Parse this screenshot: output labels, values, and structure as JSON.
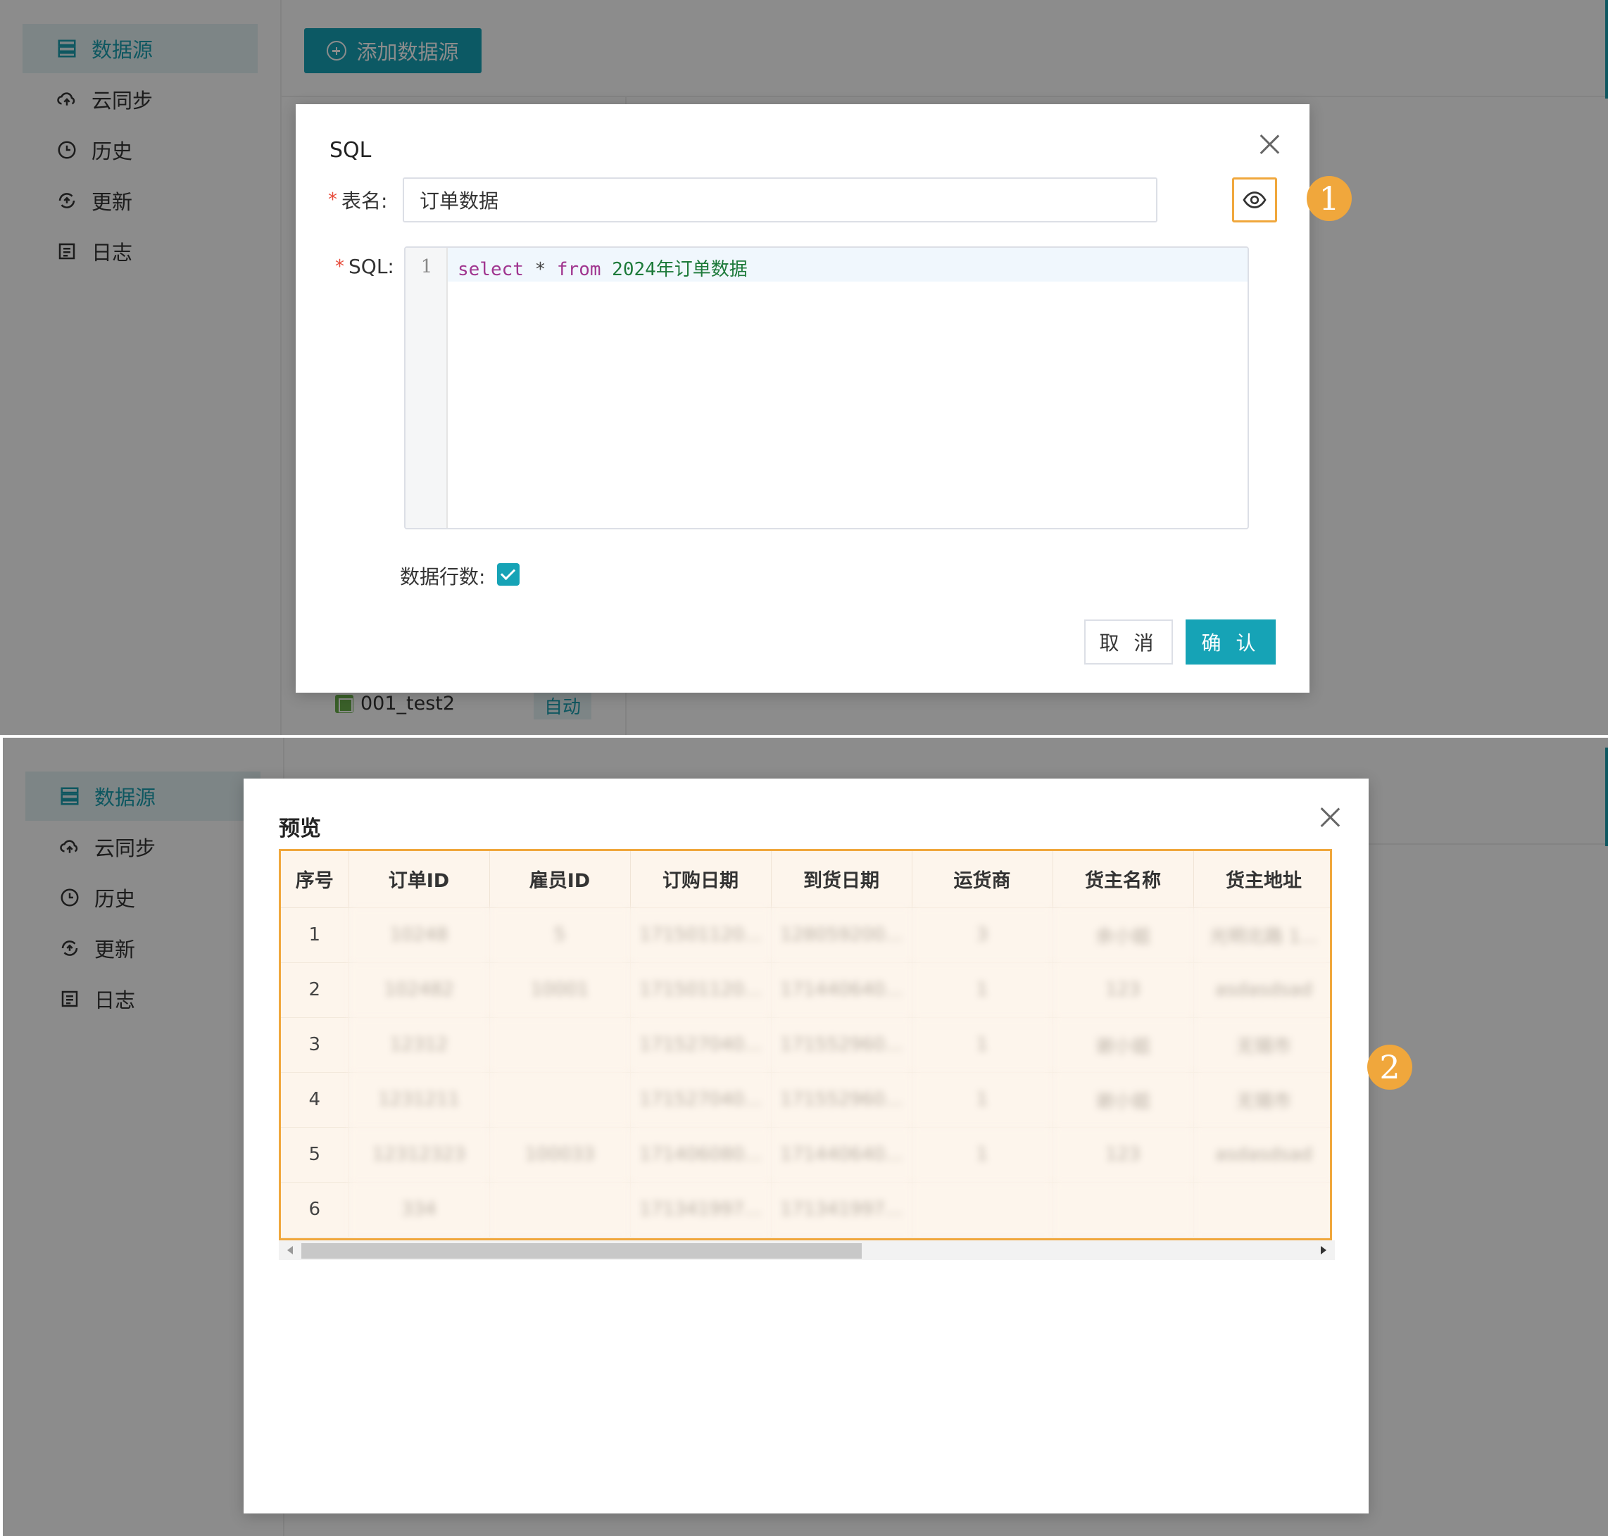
{
  "sidebar": {
    "items": [
      {
        "label": "数据源",
        "icon": "database-icon",
        "active": true
      },
      {
        "label": "云同步",
        "icon": "cloud-sync-icon"
      },
      {
        "label": "历史",
        "icon": "clock-icon"
      },
      {
        "label": "更新",
        "icon": "refresh-icon"
      },
      {
        "label": "日志",
        "icon": "log-icon"
      }
    ]
  },
  "toolbar": {
    "add_label": "添加数据源"
  },
  "list": {
    "row_name": "001_test2",
    "row_badge": "自动"
  },
  "sql_dialog": {
    "title": "SQL",
    "table_name_label": "表名:",
    "table_name_value": "订单数据",
    "sql_label": "SQL:",
    "line_number": "1",
    "code": {
      "kw1": "select",
      "op": " * ",
      "kw2": "from",
      "ident": " 2024年订单数据"
    },
    "row_count_label": "数据行数:",
    "cancel_label": "取 消",
    "ok_label": "确 认"
  },
  "badges": {
    "one": "1",
    "two": "2"
  },
  "preview_dialog": {
    "title": "预览",
    "columns": [
      "序号",
      "订单ID",
      "雇员ID",
      "订购日期",
      "到货日期",
      "运货商",
      "货主名称",
      "货主地址"
    ],
    "rows": [
      [
        "1",
        "10248",
        "5",
        "171501120...",
        "128059200...",
        "3",
        "余小姐",
        "光明北路 1..."
      ],
      [
        "2",
        "102482",
        "10001",
        "171501120...",
        "171440640...",
        "1",
        "123",
        "asdasdsad"
      ],
      [
        "3",
        "12312",
        "",
        "171527040...",
        "171552960...",
        "1",
        "谢小姐",
        "无锡市"
      ],
      [
        "4",
        "1231211",
        "",
        "171527040...",
        "171552960...",
        "1",
        "谢小姐",
        "无锡市"
      ],
      [
        "5",
        "12312323",
        "100033",
        "171406080...",
        "171440640...",
        "1",
        "123",
        "asdasdsad"
      ],
      [
        "6",
        "334",
        "",
        "171341997...",
        "171341997...",
        "",
        "",
        ""
      ]
    ]
  },
  "colors": {
    "accent": "#16a3b6",
    "highlight": "#f0a73c",
    "required": "#e74c3c"
  }
}
